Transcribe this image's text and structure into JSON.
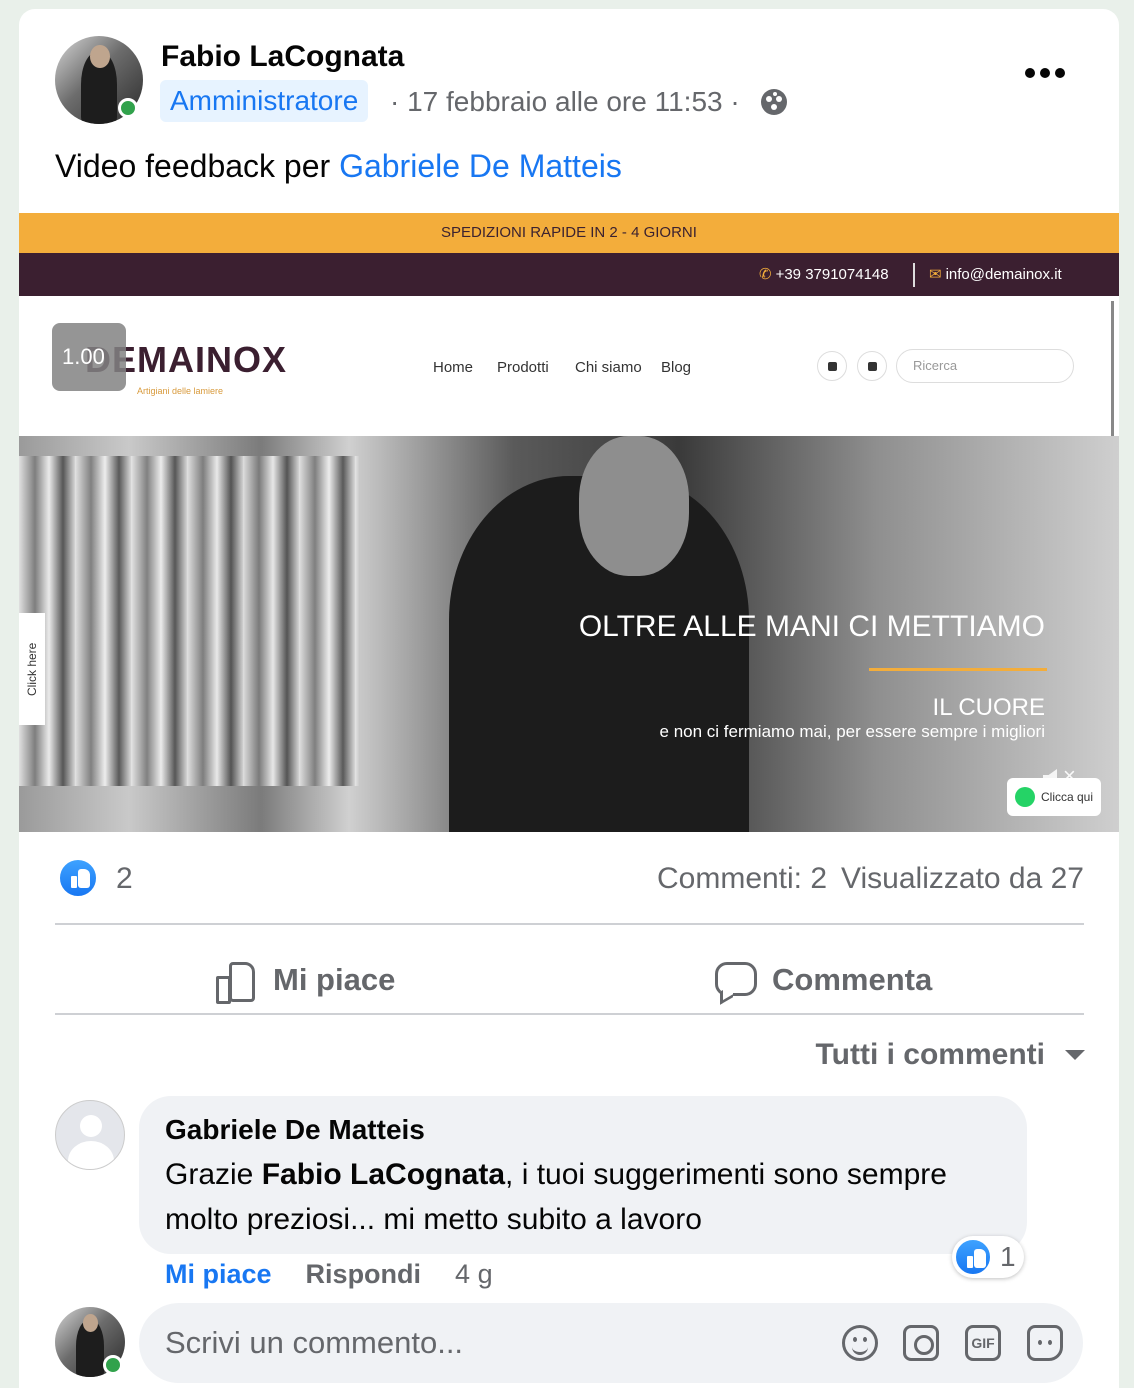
{
  "post": {
    "author": "Fabio LaCognata",
    "role_badge": "Amministratore",
    "meta": "· 17 febbraio alle ore 11:53 ·",
    "privacy_icon": "group-icon",
    "text_prefix": "Video feedback per ",
    "text_link": "Gabriele De Matteis"
  },
  "video": {
    "speed": "1.00",
    "top_bar": "SPEDIZIONI RAPIDE IN 2 - 4 GIORNI",
    "phone": "+39 3791074148",
    "email": "info@demainox.it",
    "logo": "DEMAINOX",
    "logo_sub": "Artigiani delle lamiere",
    "nav": [
      "Home",
      "Prodotti",
      "Chi siamo",
      "Blog"
    ],
    "search_placeholder": "Ricerca",
    "hero_title": "OLTRE ALLE MANI CI METTIAMO",
    "hero_sub1": "IL CUORE",
    "hero_sub2": "e non ci fermiamo mai, per essere sempre i migliori",
    "click_here": "Click here",
    "whatsapp_btn": "Clicca qui",
    "muted": true
  },
  "stats": {
    "likes": "2",
    "comments": "Commenti: 2",
    "views": "Visualizzato da 27"
  },
  "actions": {
    "like": "Mi piace",
    "comment": "Commenta"
  },
  "comments": {
    "sort_label": "Tutti i commenti",
    "items": [
      {
        "author": "Gabriele De Matteis",
        "text_before": "Grazie ",
        "mention": "Fabio LaCognata",
        "text_after": ", i tuoi suggerimenti sono sempre molto preziosi... mi metto subito a lavoro",
        "reaction_count": "1",
        "like_label": "Mi piace",
        "reply_label": "Rispondi",
        "time": "4 g"
      }
    ]
  },
  "composer": {
    "placeholder": "Scrivi un commento...",
    "gif_label": "GIF"
  },
  "colors": {
    "accent": "#1877f2",
    "online": "#31a24c",
    "secondary_text": "#65676b",
    "bubble": "#f0f2f5"
  }
}
